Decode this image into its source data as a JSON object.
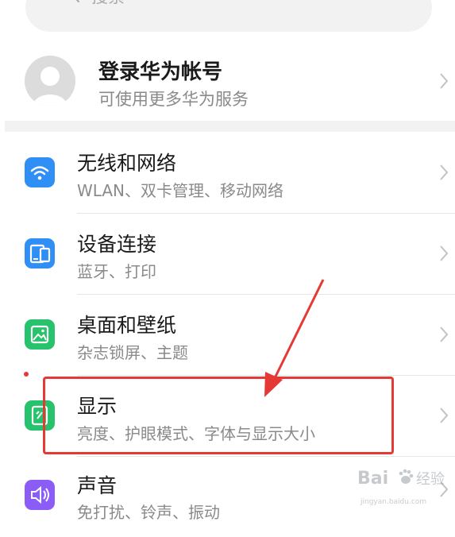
{
  "search": {
    "placeholder": "搜索"
  },
  "account": {
    "title": "登录华为帐号",
    "subtitle": "可使用更多华为服务"
  },
  "items": [
    {
      "title": "无线和网络",
      "subtitle": "WLAN、双卡管理、移动网络",
      "icon": "wifi-icon",
      "color": "#2f8ff5"
    },
    {
      "title": "设备连接",
      "subtitle": "蓝牙、打印",
      "icon": "device-connect-icon",
      "color": "#2f8ff5"
    },
    {
      "title": "桌面和壁纸",
      "subtitle": "杂志锁屏、主题",
      "icon": "wallpaper-icon",
      "color": "#27c26c"
    },
    {
      "title": "显示",
      "subtitle": "亮度、护眼模式、字体与显示大小",
      "icon": "display-icon",
      "color": "#27c26c"
    },
    {
      "title": "声音",
      "subtitle": "免打扰、铃声、振动",
      "icon": "sound-icon",
      "color": "#8b5cf6"
    }
  ],
  "watermark": {
    "brand": "Bai",
    "site": "jingyan.baidu.com",
    "cn": "经验"
  },
  "colors": {
    "highlight": "#e53935",
    "arrow": "#e53935"
  }
}
